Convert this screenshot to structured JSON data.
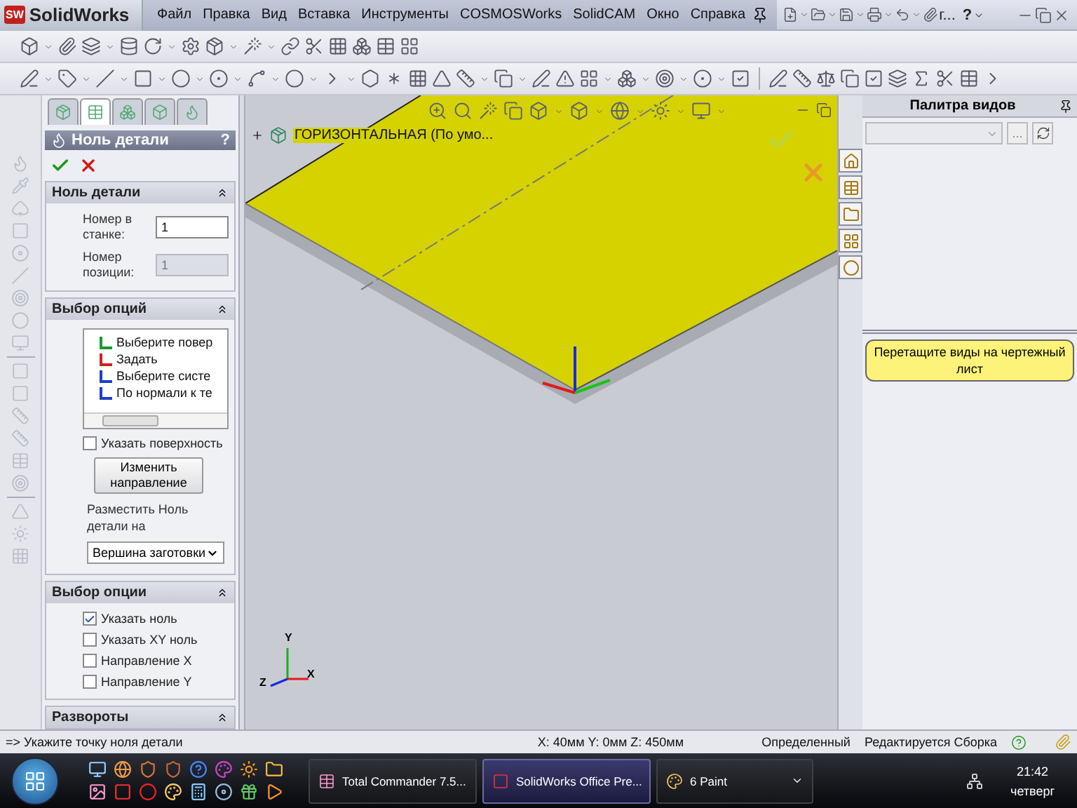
{
  "app": {
    "logo_badge": "SW",
    "logo_name": "SolidWorks"
  },
  "menu": [
    "Файл",
    "Правка",
    "Вид",
    "Вставка",
    "Инструменты",
    "COSMOSWorks",
    "SolidCAM",
    "Окно",
    "Справка"
  ],
  "title_controls": {
    "document_menu": "г...",
    "help": "?"
  },
  "property_tabs": [
    {
      "selected": false
    },
    {
      "selected": true
    },
    {
      "selected": false
    },
    {
      "selected": false
    },
    {
      "selected": false
    }
  ],
  "property_manager": {
    "title": "Ноль детали",
    "help": "?",
    "sections": [
      {
        "kind": "fields",
        "title": "Ноль детали",
        "expanded": true,
        "fields": [
          {
            "label": "Номер в станке:",
            "value": "1",
            "disabled": false
          },
          {
            "label": "Номер позиции:",
            "value": "1",
            "disabled": true
          }
        ]
      },
      {
        "kind": "options",
        "title": "Выбор опций",
        "expanded": true,
        "tree": [
          "Выберите повер",
          "Задать",
          "Выберите систе",
          "По нормали к те"
        ],
        "checkbox": {
          "label": "Указать поверхность",
          "checked": false
        },
        "button": "Изменить направление",
        "place_label": "Разместить Ноль детали на",
        "place_value": "Вершина заготовки"
      },
      {
        "kind": "checks",
        "title": "Выбор опции",
        "expanded": true,
        "checks": [
          {
            "label": "Указать ноль",
            "checked": true
          },
          {
            "label": "Указать XY ноль",
            "checked": false
          },
          {
            "label": "Направление  X",
            "checked": false
          },
          {
            "label": "Направление Y",
            "checked": false
          }
        ]
      },
      {
        "kind": "header",
        "title": "Развороты",
        "expanded": true
      }
    ]
  },
  "viewport": {
    "tree_item": "ГОРИЗОНТАЛЬНАЯ  (По умо...",
    "triad_labels": [
      "Y",
      "X",
      "Z"
    ]
  },
  "view_palette": {
    "title": "Палитра видов",
    "browse": "...",
    "hint": "Перетащите виды на чертежный лист"
  },
  "status_bar": {
    "prompt": "=> Укажите точку ноля детали",
    "coords": "X: 40мм  Y: 0мм  Z: 450мм",
    "state": "Определенный",
    "mode": "Редактируется Сборка"
  },
  "taskbar": {
    "tasks": [
      {
        "label": "Total Commander 7.5...",
        "selected": false,
        "kind": "single"
      },
      {
        "label": "SolidWorks Office Pre...",
        "selected": true,
        "kind": "single"
      },
      {
        "label": "6 Paint",
        "selected": false,
        "kind": "group"
      }
    ],
    "time": "21:42",
    "day": "четверг"
  }
}
